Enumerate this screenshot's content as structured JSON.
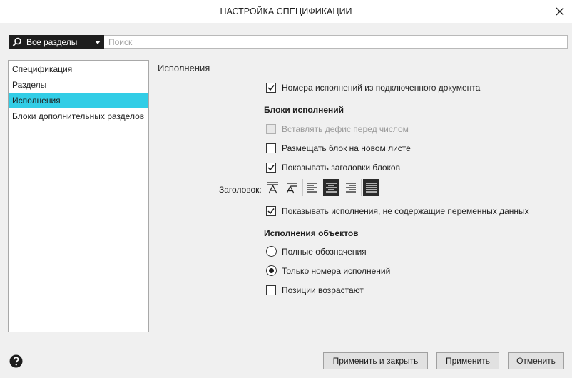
{
  "window": {
    "title": "НАСТРОЙКА СПЕЦИФИКАЦИИ"
  },
  "toolbar": {
    "section_dropdown": "Все разделы",
    "search_placeholder": "Поиск"
  },
  "nav": {
    "items": [
      {
        "label": "Спецификация",
        "active": false
      },
      {
        "label": "Разделы",
        "active": false
      },
      {
        "label": "Исполнения",
        "active": true
      },
      {
        "label": "Блоки дополнительных разделов",
        "active": false
      }
    ]
  },
  "panel": {
    "title": "Исполнения",
    "numbers_from_doc": {
      "label": "Номера исполнений из подключенного документа",
      "checked": true
    },
    "blocks": {
      "title": "Блоки исполнений",
      "hyphen": {
        "label": "Вставлять дефис перед числом",
        "checked": false,
        "disabled": true
      },
      "new_sheet": {
        "label": "Размещать блок на новом листе",
        "checked": false
      },
      "show_headers": {
        "label": "Показывать заголовки блоков",
        "checked": true
      },
      "heading_label": "Заголовок:",
      "show_without_vars": {
        "label": "Показывать исполнения, не содержащие переменных данных",
        "checked": true
      }
    },
    "objects": {
      "title": "Исполнения объектов",
      "full": {
        "label": "Полные обозначения",
        "selected": false
      },
      "numbers_only": {
        "label": "Только номера исполнений",
        "selected": true
      },
      "ascending": {
        "label": "Позиции возрастают",
        "checked": false
      }
    }
  },
  "buttons": {
    "apply_close": "Применить и закрыть",
    "apply": "Применить",
    "cancel": "Отменить"
  },
  "colors": {
    "accent": "#32cde6",
    "selected_tool": "#2b2b2b"
  }
}
